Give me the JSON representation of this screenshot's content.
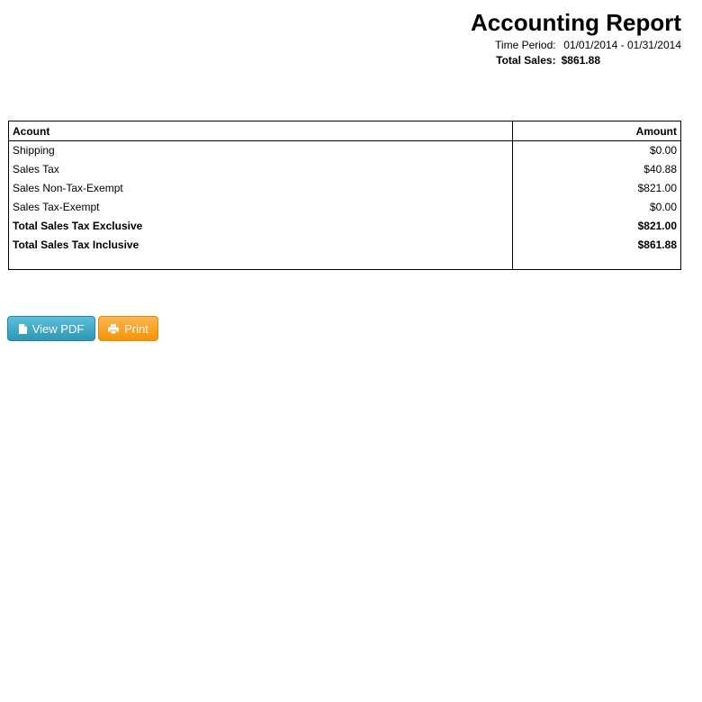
{
  "report": {
    "title": "Accounting Report",
    "time_period_label": "Time Period:",
    "time_period_value": "01/01/2014 - 01/31/2014",
    "total_sales_label": "Total Sales:",
    "total_sales_value": "$861.88"
  },
  "table": {
    "headers": {
      "account": "Acount",
      "amount": "Amount"
    },
    "rows": [
      {
        "account": "Shipping",
        "amount": "$0.00"
      },
      {
        "account": "Sales Tax",
        "amount": "$40.88"
      },
      {
        "account": "Sales Non-Tax-Exempt",
        "amount": "$821.00"
      },
      {
        "account": "Sales Tax-Exempt",
        "amount": "$0.00"
      },
      {
        "account": "Total Sales Tax Exclusive",
        "amount": "$821.00"
      },
      {
        "account": "Total Sales Tax Inclusive",
        "amount": "$861.88"
      }
    ]
  },
  "buttons": {
    "view_pdf": "View PDF",
    "print": "Print",
    "view_pdf_icon": "document-icon",
    "print_icon": "printer-icon",
    "view_pdf_color": "#49afcd",
    "print_color": "#faa732"
  }
}
